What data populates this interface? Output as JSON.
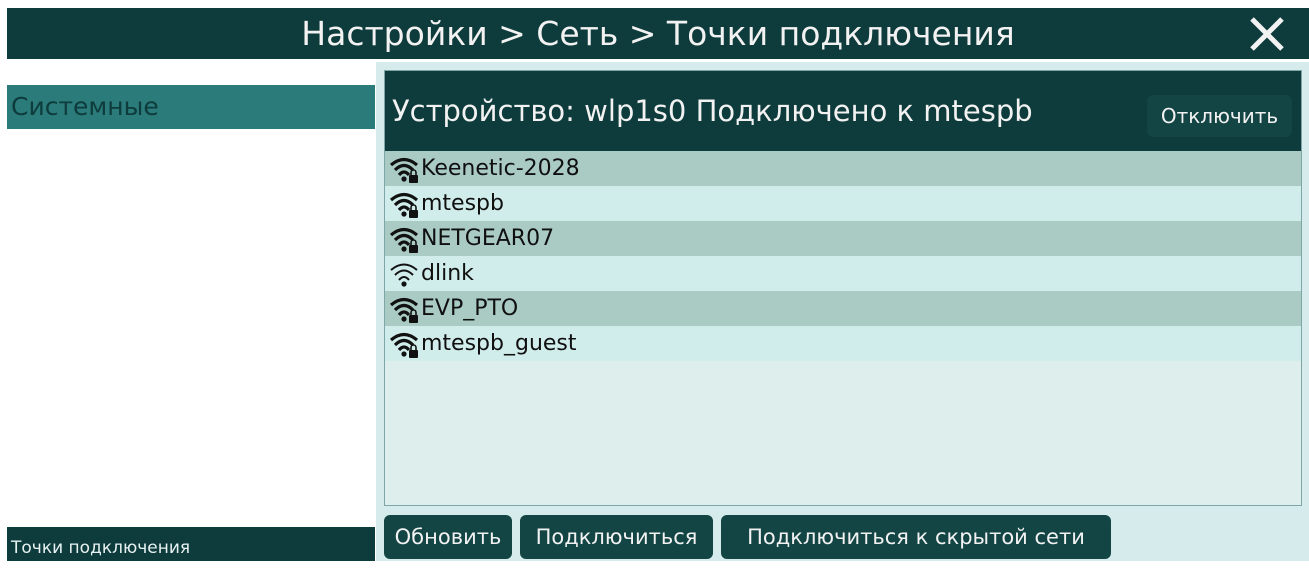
{
  "window": {
    "title": "Настройки > Сеть > Точки подключения",
    "close_label": "X"
  },
  "sidebar": {
    "selected_item": "Системные",
    "footer_label": "Точки подключения"
  },
  "device": {
    "status_text": "Устройство: wlp1s0 Подключено к mtespb",
    "disconnect_label": "Отключить"
  },
  "networks": [
    {
      "ssid": "Keenetic-2028",
      "secured": true,
      "icon": "wifi-lock-icon"
    },
    {
      "ssid": "mtespb",
      "secured": true,
      "icon": "wifi-lock-icon"
    },
    {
      "ssid": "NETGEAR07",
      "secured": true,
      "icon": "wifi-lock-icon"
    },
    {
      "ssid": "dlink",
      "secured": false,
      "icon": "wifi-icon"
    },
    {
      "ssid": "EVP_PTO",
      "secured": true,
      "icon": "wifi-lock-icon"
    },
    {
      "ssid": "mtespb_guest",
      "secured": true,
      "icon": "wifi-lock-icon"
    }
  ],
  "actions": {
    "refresh_label": "Обновить",
    "connect_label": "Подключиться",
    "connect_hidden_label": "Подключиться к скрытой сети"
  },
  "colors": {
    "dark_teal": "#0e3b3b",
    "accent_teal": "#2b7b7b",
    "row_odd": "#a9cbc3",
    "row_even": "#d0edeb"
  }
}
